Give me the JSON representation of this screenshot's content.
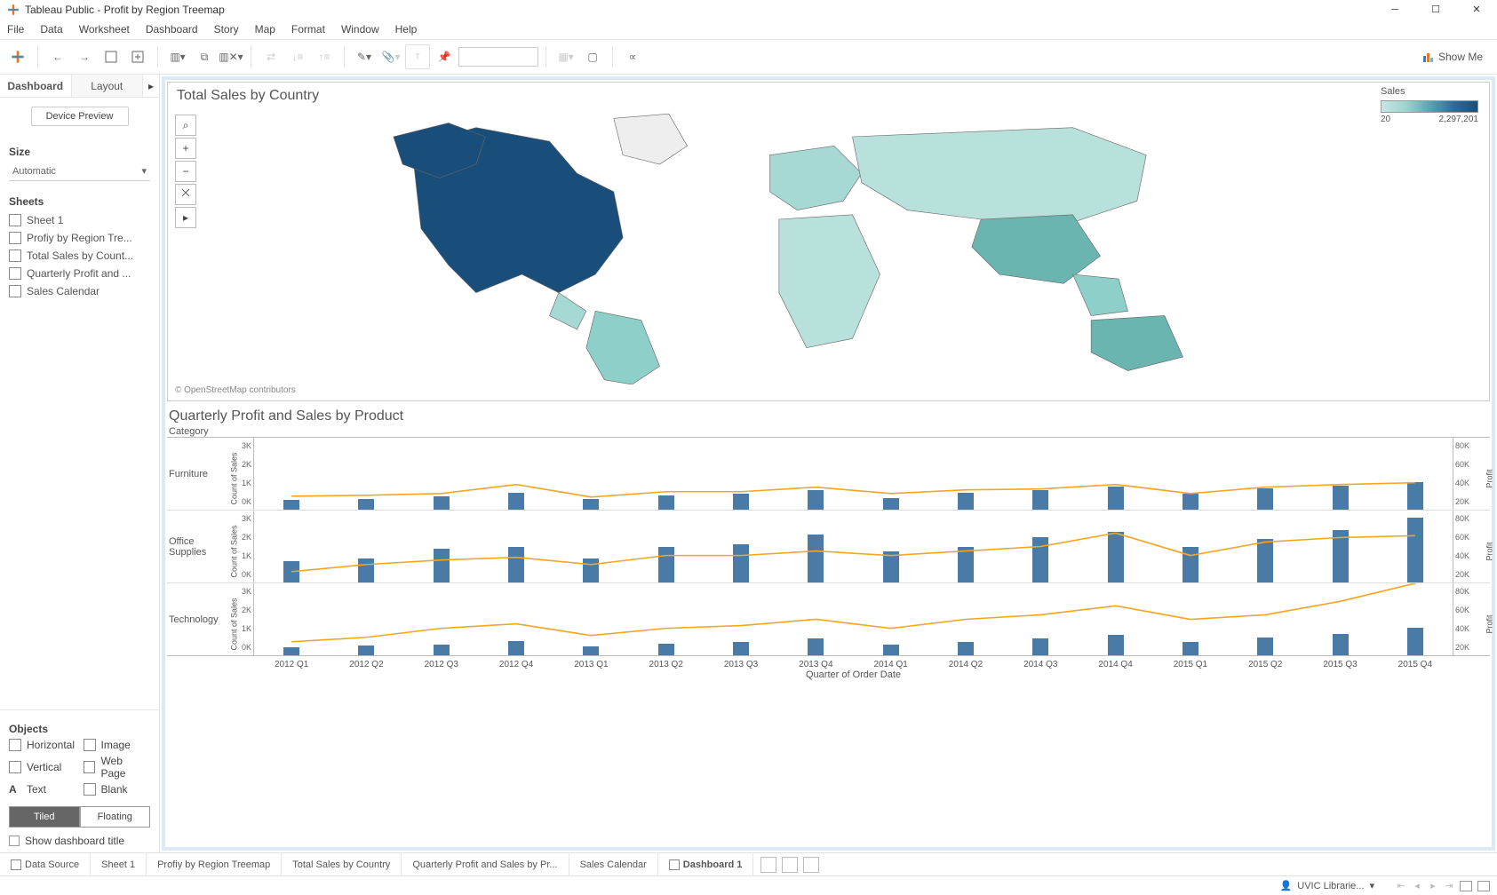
{
  "titlebar": {
    "title": "Tableau Public - Profit by Region Treemap"
  },
  "menu": [
    "File",
    "Data",
    "Worksheet",
    "Dashboard",
    "Story",
    "Map",
    "Format",
    "Window",
    "Help"
  ],
  "showme": "Show Me",
  "sidebar": {
    "tabs": [
      "Dashboard",
      "Layout"
    ],
    "device_preview": "Device Preview",
    "size_heading": "Size",
    "size_value": "Automatic",
    "sheets_heading": "Sheets",
    "sheets": [
      "Sheet 1",
      "Profiy by Region Tre...",
      "Total Sales by Count...",
      "Quarterly Profit and ...",
      "Sales Calendar"
    ],
    "objects_heading": "Objects",
    "objects": [
      "Horizontal",
      "Image",
      "Vertical",
      "Web Page",
      "Text",
      "Blank"
    ],
    "tiled": "Tiled",
    "floating": "Floating",
    "show_title": "Show dashboard title"
  },
  "map": {
    "title": "Total Sales by Country",
    "legend_title": "Sales",
    "legend_min": "20",
    "legend_max": "2,297,201",
    "attribution": "© OpenStreetMap contributors"
  },
  "chart": {
    "title": "Quarterly Profit and Sales by Product",
    "category_label": "Category",
    "categories": [
      "Furniture",
      "Office Supplies",
      "Technology"
    ],
    "left_axis": "Count of Sales",
    "right_axis": "Profit",
    "left_ticks": [
      "3K",
      "2K",
      "1K",
      "0K"
    ],
    "right_ticks": [
      "80K",
      "60K",
      "40K",
      "20K"
    ],
    "x_title": "Quarter of Order Date",
    "x_labels": [
      "2012 Q1",
      "2012 Q2",
      "2012 Q3",
      "2012 Q4",
      "2013 Q1",
      "2013 Q2",
      "2013 Q3",
      "2013 Q4",
      "2014 Q1",
      "2014 Q2",
      "2014 Q3",
      "2014 Q4",
      "2015 Q1",
      "2015 Q2",
      "2015 Q3",
      "2015 Q4"
    ]
  },
  "chart_data": [
    {
      "type": "bar+line",
      "category": "Furniture",
      "x": [
        "2012 Q1",
        "2012 Q2",
        "2012 Q3",
        "2012 Q4",
        "2013 Q1",
        "2013 Q2",
        "2013 Q3",
        "2013 Q4",
        "2014 Q1",
        "2014 Q2",
        "2014 Q3",
        "2014 Q4",
        "2015 Q1",
        "2015 Q2",
        "2015 Q3",
        "2015 Q4"
      ],
      "bars_count_of_sales": [
        400,
        450,
        550,
        700,
        450,
        600,
        650,
        800,
        500,
        700,
        800,
        950,
        650,
        900,
        1000,
        1150
      ],
      "line_profit": [
        15000,
        16000,
        18000,
        28000,
        14000,
        20000,
        20000,
        25000,
        18000,
        22000,
        23000,
        28000,
        18000,
        25000,
        28000,
        30000
      ],
      "ylim_left": [
        0,
        3000
      ],
      "ylim_right": [
        0,
        80000
      ]
    },
    {
      "type": "bar+line",
      "category": "Office Supplies",
      "x": [
        "2012 Q1",
        "2012 Q2",
        "2012 Q3",
        "2012 Q4",
        "2013 Q1",
        "2013 Q2",
        "2013 Q3",
        "2013 Q4",
        "2014 Q1",
        "2014 Q2",
        "2014 Q3",
        "2014 Q4",
        "2015 Q1",
        "2015 Q2",
        "2015 Q3",
        "2015 Q4"
      ],
      "bars_count_of_sales": [
        900,
        1000,
        1400,
        1500,
        1000,
        1500,
        1600,
        2000,
        1300,
        1500,
        1900,
        2100,
        1500,
        1800,
        2200,
        2700
      ],
      "line_profit": [
        12000,
        20000,
        25000,
        28000,
        20000,
        30000,
        30000,
        35000,
        30000,
        35000,
        40000,
        55000,
        30000,
        45000,
        50000,
        52000
      ],
      "ylim_left": [
        0,
        3000
      ],
      "ylim_right": [
        0,
        80000
      ]
    },
    {
      "type": "bar+line",
      "category": "Technology",
      "x": [
        "2012 Q1",
        "2012 Q2",
        "2012 Q3",
        "2012 Q4",
        "2013 Q1",
        "2013 Q2",
        "2013 Q3",
        "2013 Q4",
        "2014 Q1",
        "2014 Q2",
        "2014 Q3",
        "2014 Q4",
        "2015 Q1",
        "2015 Q2",
        "2015 Q3",
        "2015 Q4"
      ],
      "bars_count_of_sales": [
        350,
        400,
        450,
        600,
        380,
        500,
        550,
        700,
        450,
        550,
        700,
        850,
        550,
        750,
        900,
        1150
      ],
      "line_profit": [
        15000,
        20000,
        30000,
        35000,
        22000,
        30000,
        33000,
        40000,
        30000,
        40000,
        45000,
        55000,
        40000,
        45000,
        60000,
        80000
      ],
      "ylim_left": [
        0,
        3000
      ],
      "ylim_right": [
        0,
        80000
      ]
    }
  ],
  "sheet_tabs": {
    "data_source": "Data Source",
    "tabs": [
      "Sheet 1",
      "Profiy by Region Treemap",
      "Total Sales by Country",
      "Quarterly Profit and Sales by Pr...",
      "Sales Calendar",
      "Dashboard 1"
    ]
  },
  "statusbar": {
    "user": "UVIC Librarie..."
  }
}
